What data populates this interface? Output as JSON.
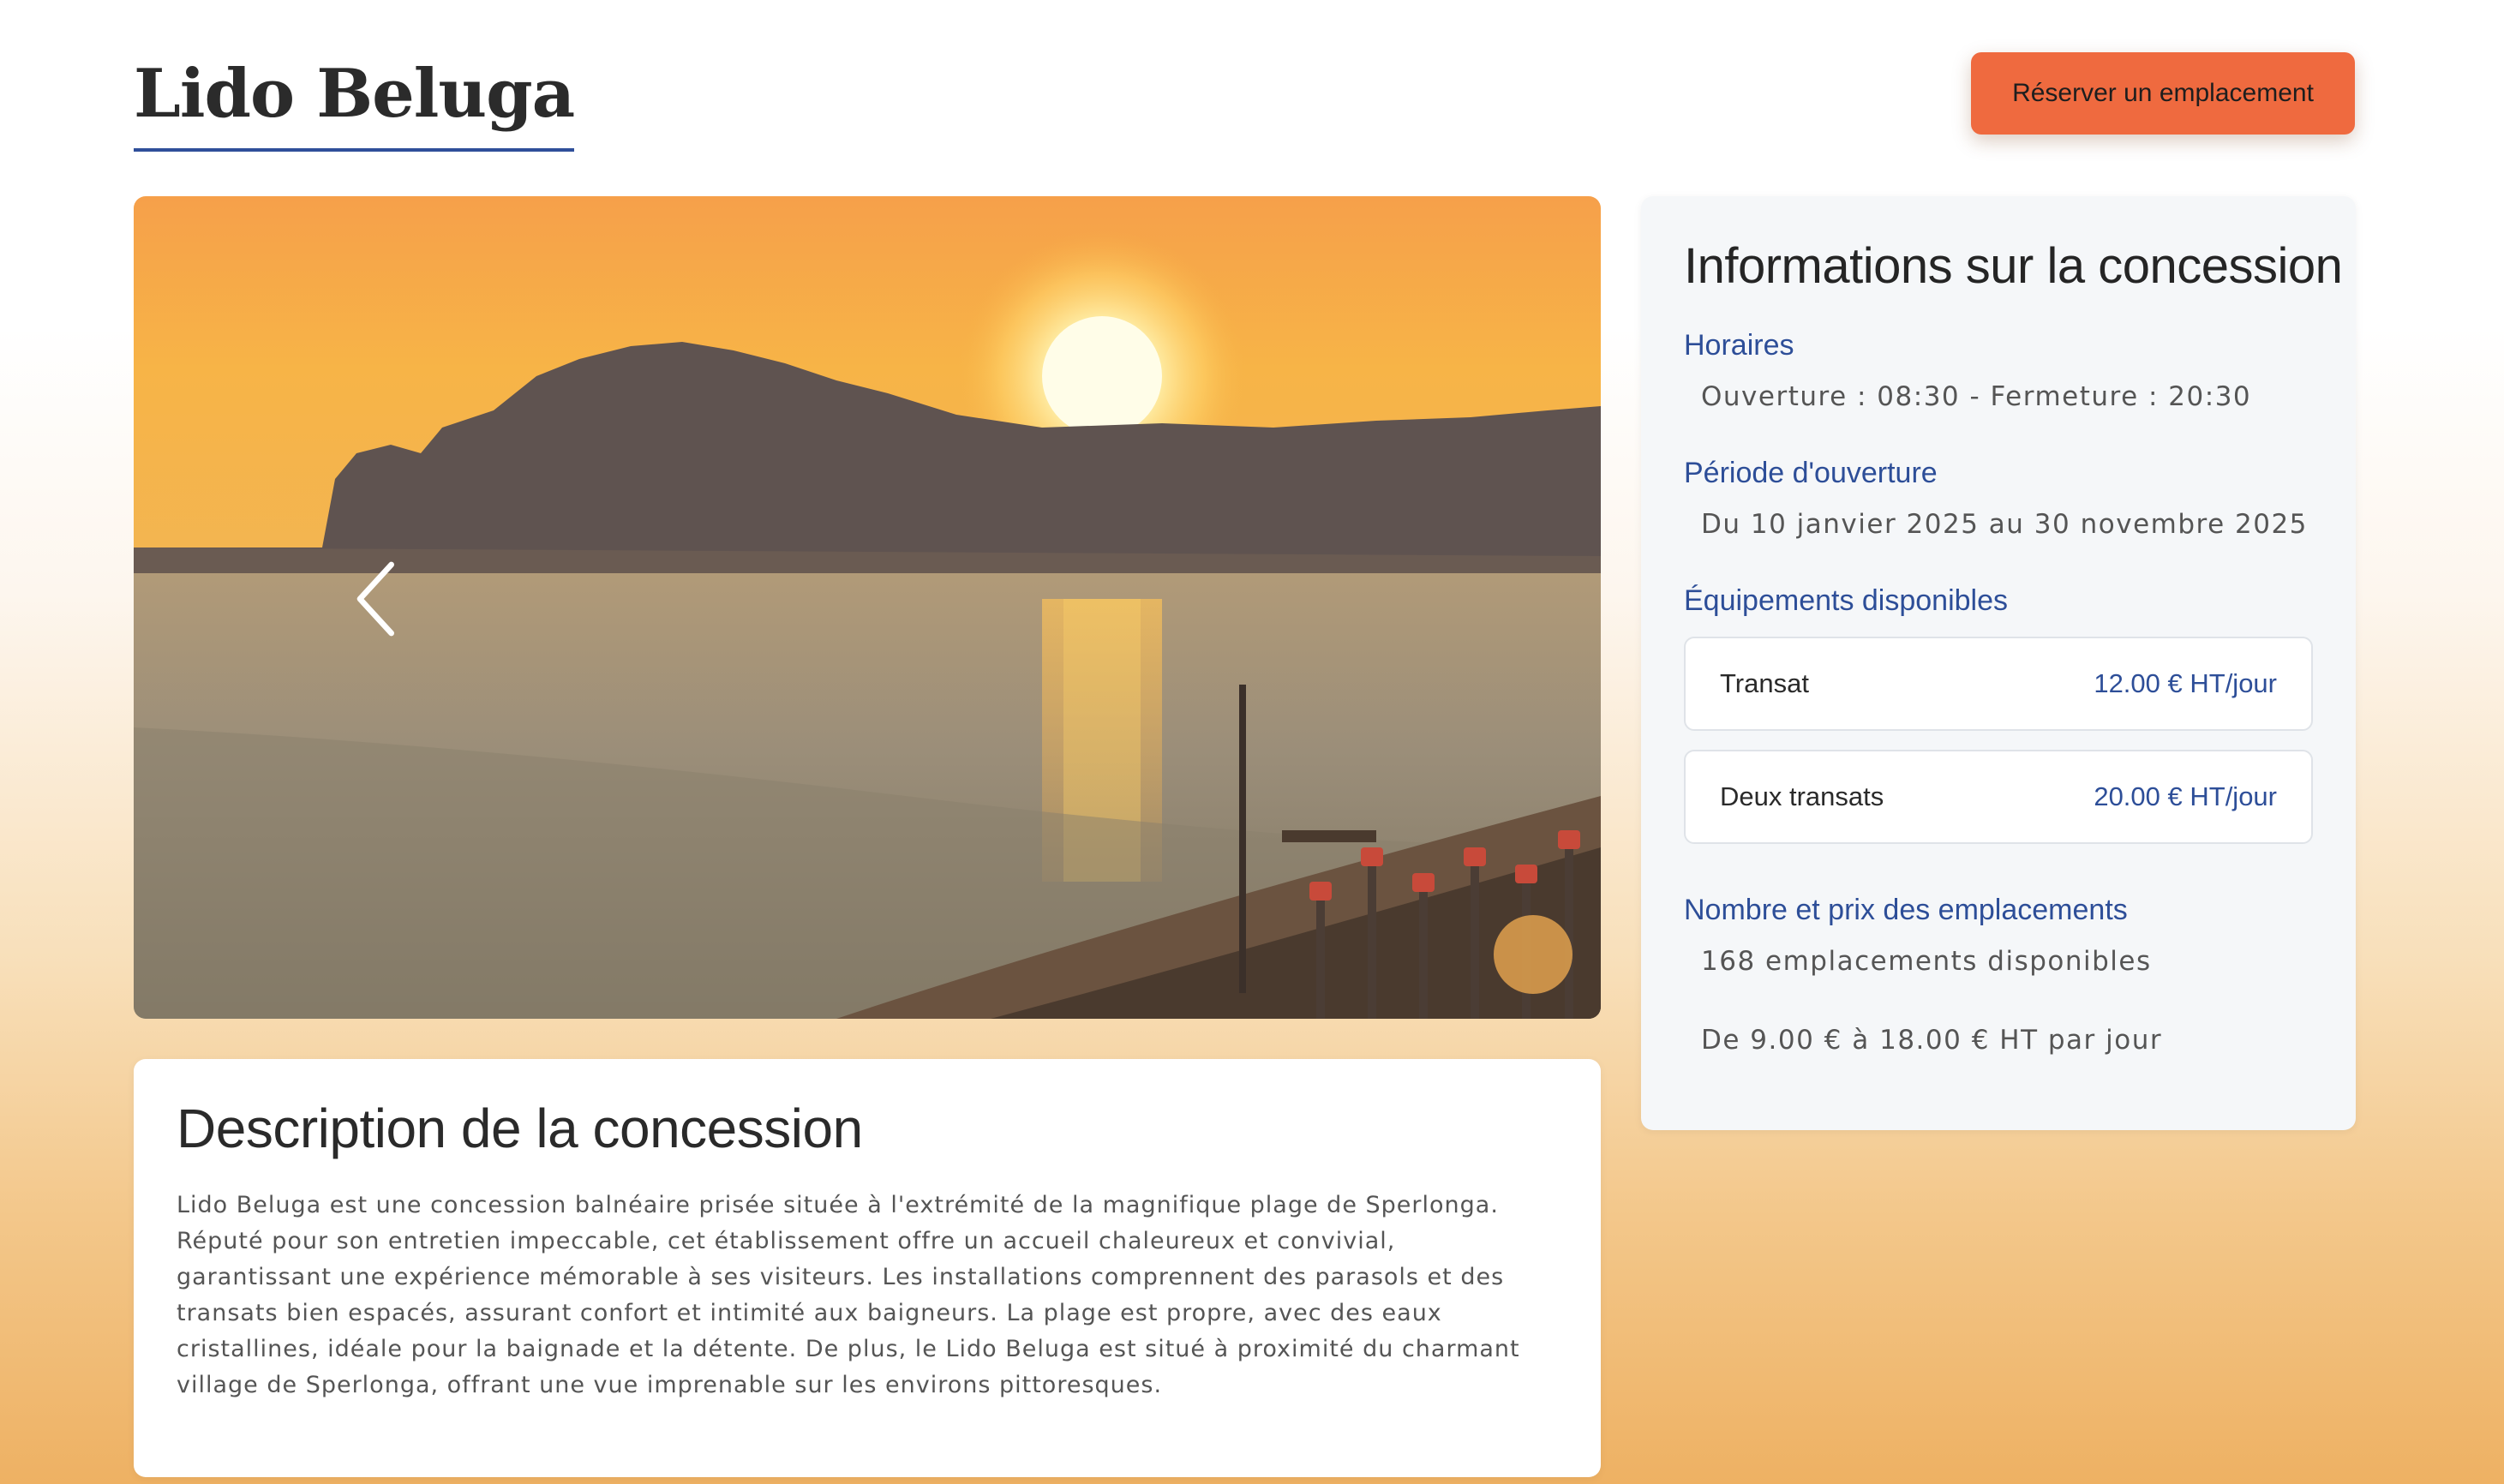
{
  "header": {
    "title": "Lido Beluga",
    "reserve_button": "Réserver un emplacement"
  },
  "carousel": {
    "image_alt": "Coucher de soleil sur la plage de Sperlonga",
    "prev_icon": "chevron-left-icon",
    "next_icon": "chevron-right-icon"
  },
  "description": {
    "title": "Description de la concession",
    "text": "Lido Beluga est une concession balnéaire prisée située à l'extrémité de la magnifique plage de Sperlonga. Réputé pour son entretien impeccable, cet établissement offre un accueil chaleureux et convivial, garantissant une expérience mémorable à ses visiteurs. Les installations comprennent des parasols et des transats bien espacés, assurant confort et intimité aux baigneurs. La plage est propre, avec des eaux cristallines, idéale pour la baignade et la détente. De plus, le Lido Beluga est situé à proximité du charmant village de Sperlonga, offrant une vue imprenable sur les environs pittoresques."
  },
  "info": {
    "title": "Informations sur la concession",
    "hours_label": "Horaires",
    "hours_value": "Ouverture : 08:30 - Fermeture : 20:30",
    "period_label": "Période d'ouverture",
    "period_value": "Du 10 janvier 2025 au 30 novembre 2025",
    "equipment_label": "Équipements disponibles",
    "equipment": [
      {
        "name": "Transat",
        "price": "12.00 € HT/jour"
      },
      {
        "name": "Deux transats",
        "price": "20.00 € HT/jour"
      }
    ],
    "spots_label": "Nombre et prix des emplacements",
    "spots_count": "168 emplacements disponibles",
    "spots_price": "De 9.00 € à 18.00 € HT par jour"
  },
  "colors": {
    "accent_blue": "#2d4e98",
    "button_orange": "#ef6a3f"
  }
}
